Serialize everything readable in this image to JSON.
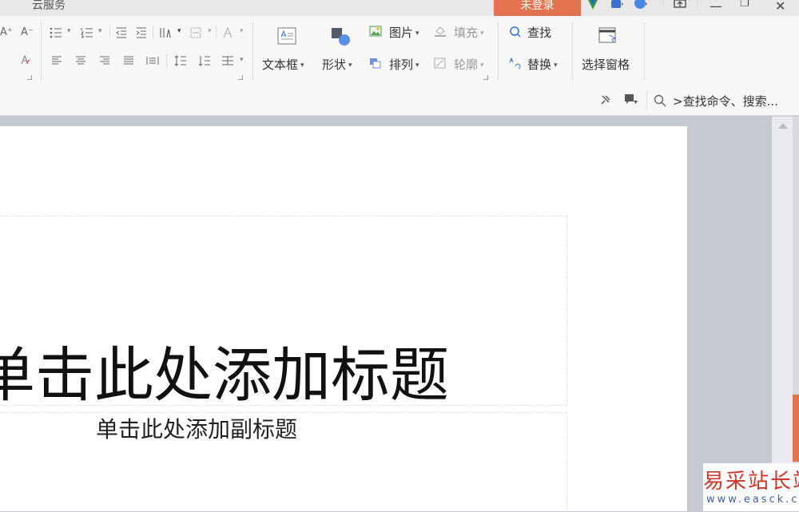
{
  "titlebar": {
    "tab": "云服务",
    "login": "未登录",
    "window_controls": [
      "—",
      "❐",
      "✕"
    ]
  },
  "ribbon": {
    "font_controls": [
      "A⁺",
      "A⁻"
    ],
    "textbox_label": "文本框",
    "shape_label": "形状",
    "picture_label": "图片",
    "fill_label": "填充",
    "arrange_label": "排列",
    "outline_label": "轮廓",
    "find_label": "查找",
    "replace_label": "替换",
    "selection_pane_label": "选择窗格",
    "caret": "▾"
  },
  "search": {
    "text": ">查找命令、搜索..."
  },
  "slide": {
    "title_placeholder": "单击此处添加标题",
    "subtitle_placeholder": "单击此处添加副标题"
  },
  "watermark": {
    "main": "易采站长站",
    "url": "www.easck.com"
  },
  "colors": {
    "accent": "#e4734f",
    "ribbon_bg": "#f7f7f7",
    "canvas_bg": "#c7c9d0"
  }
}
